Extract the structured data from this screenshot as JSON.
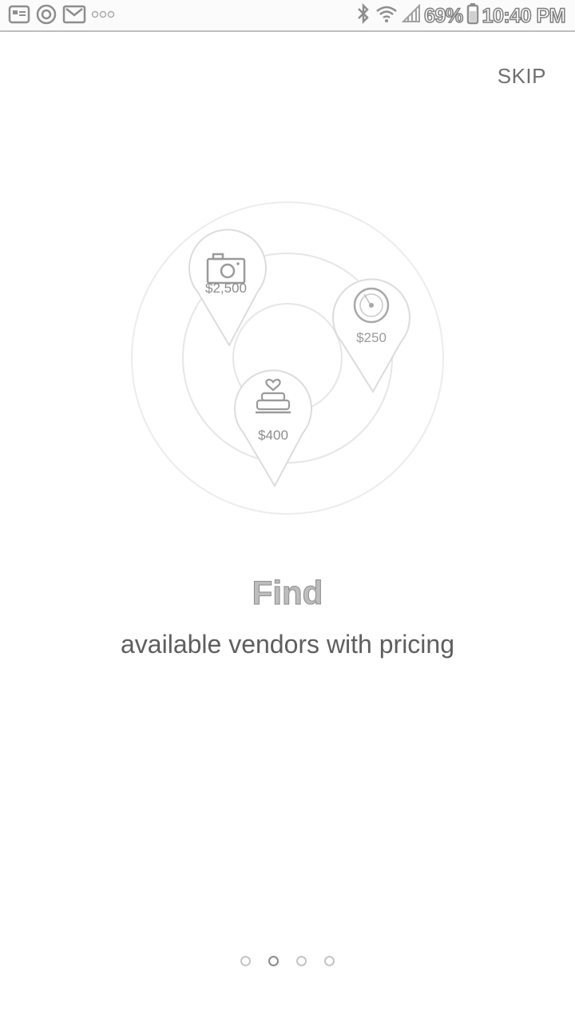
{
  "status_bar": {
    "icons_left": [
      "gallery-icon",
      "target-icon",
      "gmail-icon",
      "more-notifications-icon"
    ],
    "icons_right": [
      "bluetooth-icon",
      "wifi-icon",
      "signal-icon",
      "battery-icon"
    ],
    "battery": "69%",
    "time": "10:40 PM"
  },
  "skip_label": "SKIP",
  "pins": [
    {
      "icon": "camera-icon",
      "price": "$2,500"
    },
    {
      "icon": "vinyl-record-icon",
      "price": "$250"
    },
    {
      "icon": "wedding-cake-icon",
      "price": "$400"
    }
  ],
  "title": "Find",
  "subtitle": "available vendors with pricing",
  "pager": {
    "count": 4,
    "active_index": 1
  }
}
